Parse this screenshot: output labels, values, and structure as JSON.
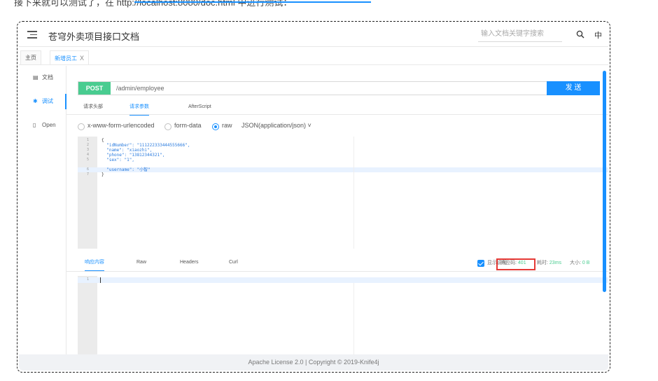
{
  "top_strip": {
    "text": "接下来就可以测试了，在 http://localhost:8080/doc.html 中进行测试："
  },
  "header": {
    "title": "苍穹外卖项目接口文档",
    "search_placeholder": "输入文档关键字搜索",
    "lang": "中"
  },
  "tabs": [
    {
      "label": "主页"
    },
    {
      "label": "新增员工",
      "close": "X"
    }
  ],
  "sidebar": {
    "items": [
      {
        "icon": "document-icon",
        "label": "文档"
      },
      {
        "icon": "bug-icon",
        "label": "调试"
      },
      {
        "icon": "file-icon",
        "label": "Open"
      }
    ]
  },
  "request": {
    "method": "POST",
    "url": "/admin/employee",
    "send_label": "发 送",
    "tabs": [
      "请求头部",
      "请求参数",
      "AfterScript"
    ],
    "active_tab": "请求参数",
    "body_types": [
      "x-www-form-urlencoded",
      "form-data",
      "raw",
      "JSON(application/json)"
    ],
    "selected_body_type": "raw",
    "line_numbers": [
      "1",
      "2",
      "3",
      "4",
      "5",
      "6",
      "7"
    ],
    "code_lines": [
      "{",
      "  \"idNumber\": \"111222333444555666\",",
      "  \"name\": \"xiaozhi\",",
      "  \"phone\": \"13812344321\",",
      "  \"sex\": \"1\",",
      "  \"username\": \"小智\"",
      "}"
    ]
  },
  "response": {
    "tabs": [
      "响应内容",
      "Raw",
      "Headers",
      "Curl"
    ],
    "active_tab": "响应内容",
    "show_desc_label": "显示说明",
    "code_label": "响应码:",
    "code_value": "401",
    "time_label": "耗时:",
    "time_value": "23ms",
    "size_label": "大小:",
    "size_value": "0 B",
    "line_numbers": [
      "1"
    ]
  },
  "footer": {
    "text": "Apache License 2.0 | Copyright © 2019-Knife4j"
  },
  "colors": {
    "accent": "#1890ff",
    "post": "#49cc90",
    "highlight_border": "#e53935"
  }
}
